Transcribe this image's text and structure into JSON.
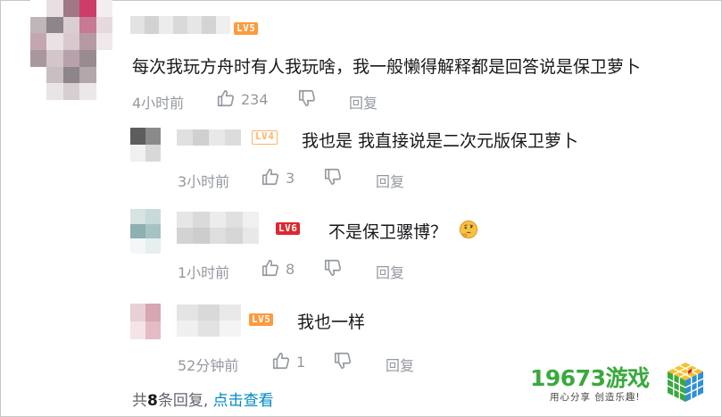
{
  "comments": [
    {
      "id": "main",
      "level": "LV5",
      "text": "每次我玩方舟时有人我玩啥，我一般懒得解释都是回答说是保卫萝卜",
      "time": "4小时前",
      "likes": "234",
      "reply_label": "回复"
    },
    {
      "id": "reply-1",
      "level": "LV4",
      "text": "我也是 我直接说是二次元版保卫萝卜",
      "time": "3小时前",
      "likes": "3",
      "reply_label": "回复"
    },
    {
      "id": "reply-2",
      "level": "LV6",
      "text": "不是保卫骡博？",
      "emoji": "thinking-face",
      "time": "1小时前",
      "likes": "8",
      "reply_label": "回复"
    },
    {
      "id": "reply-3",
      "level": "LV5",
      "text": "我也一样",
      "time": "52分钟前",
      "likes": "1",
      "reply_label": "回复"
    }
  ],
  "footer": {
    "prefix": "共",
    "count": "8",
    "suffix": "条回复,",
    "link": "点击查看"
  },
  "watermark": {
    "name": "19673游戏",
    "slogan": "用心分享  创造乐趣!"
  },
  "colors": {
    "level_orange": "#ff9a3d",
    "level_red": "#e0262e",
    "link": "#008ac5",
    "meta_gray": "#9499a0",
    "logo_green": "#3aa93d"
  }
}
